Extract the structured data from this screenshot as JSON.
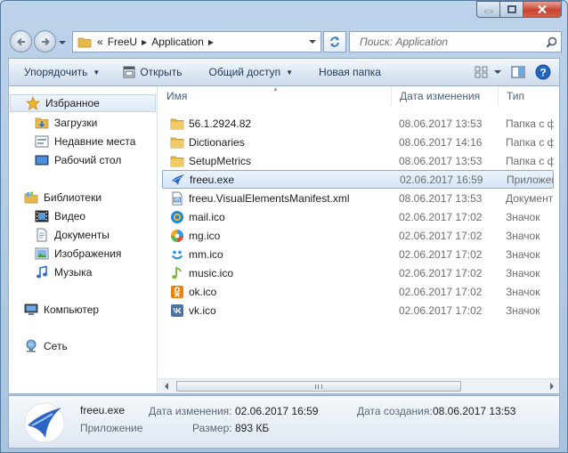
{
  "window": {
    "path": [
      "FreeU",
      "Application"
    ],
    "path_prefix": "«",
    "search_placeholder": "Поиск: Application"
  },
  "toolbar": {
    "organize": "Упорядочить",
    "open": "Открыть",
    "share": "Общий доступ",
    "new_folder": "Новая папка"
  },
  "navpane": {
    "favorites": "Избранное",
    "downloads": "Загрузки",
    "recent": "Недавние места",
    "desktop": "Рабочий стол",
    "libraries": "Библиотеки",
    "video": "Видео",
    "documents": "Документы",
    "pictures": "Изображения",
    "music": "Музыка",
    "computer": "Компьютер",
    "network": "Сеть"
  },
  "columns": {
    "name": "Имя",
    "date": "Дата изменения",
    "type": "Тип"
  },
  "files": [
    {
      "name": "56.1.2924.82",
      "date": "08.06.2017 13:53",
      "type": "Папка с фай",
      "icon": "folder-icon"
    },
    {
      "name": "Dictionaries",
      "date": "08.06.2017 14:16",
      "type": "Папка с фай",
      "icon": "folder-icon"
    },
    {
      "name": "SetupMetrics",
      "date": "08.06.2017 13:53",
      "type": "Папка с фай",
      "icon": "folder-icon"
    },
    {
      "name": "freeu.exe",
      "date": "02.06.2017 16:59",
      "type": "Приложени",
      "icon": "freeu-app-icon"
    },
    {
      "name": "freeu.VisualElementsManifest.xml",
      "date": "08.06.2017 13:53",
      "type": "Документ X",
      "icon": "xml-document-icon"
    },
    {
      "name": "mail.ico",
      "date": "02.06.2017 17:02",
      "type": "Значок",
      "icon": "mail-icon"
    },
    {
      "name": "mg.ico",
      "date": "02.06.2017 17:02",
      "type": "Значок",
      "icon": "mg-icon"
    },
    {
      "name": "mm.ico",
      "date": "02.06.2017 17:02",
      "type": "Значок",
      "icon": "mm-icon"
    },
    {
      "name": "music.ico",
      "date": "02.06.2017 17:02",
      "type": "Значок",
      "icon": "music-note-icon"
    },
    {
      "name": "ok.ico",
      "date": "02.06.2017 17:02",
      "type": "Значок",
      "icon": "ok-icon"
    },
    {
      "name": "vk.ico",
      "date": "02.06.2017 17:02",
      "type": "Значок",
      "icon": "vk-icon"
    }
  ],
  "details": {
    "name": "freeu.exe",
    "type": "Приложение",
    "modified_label": "Дата изменения:",
    "modified": "02.06.2017 16:59",
    "created_label": "Дата создания:",
    "created": "08.06.2017 13:53",
    "size_label": "Размер:",
    "size": "893 КБ"
  },
  "colors": {
    "selection": "#d5e6f8",
    "selection_border": "#84acdd",
    "folder": "#e8b84a",
    "freeu_blue": "#2b63c6",
    "mail": "#168de2",
    "ok": "#ee8208",
    "vk": "#4c75a3"
  }
}
